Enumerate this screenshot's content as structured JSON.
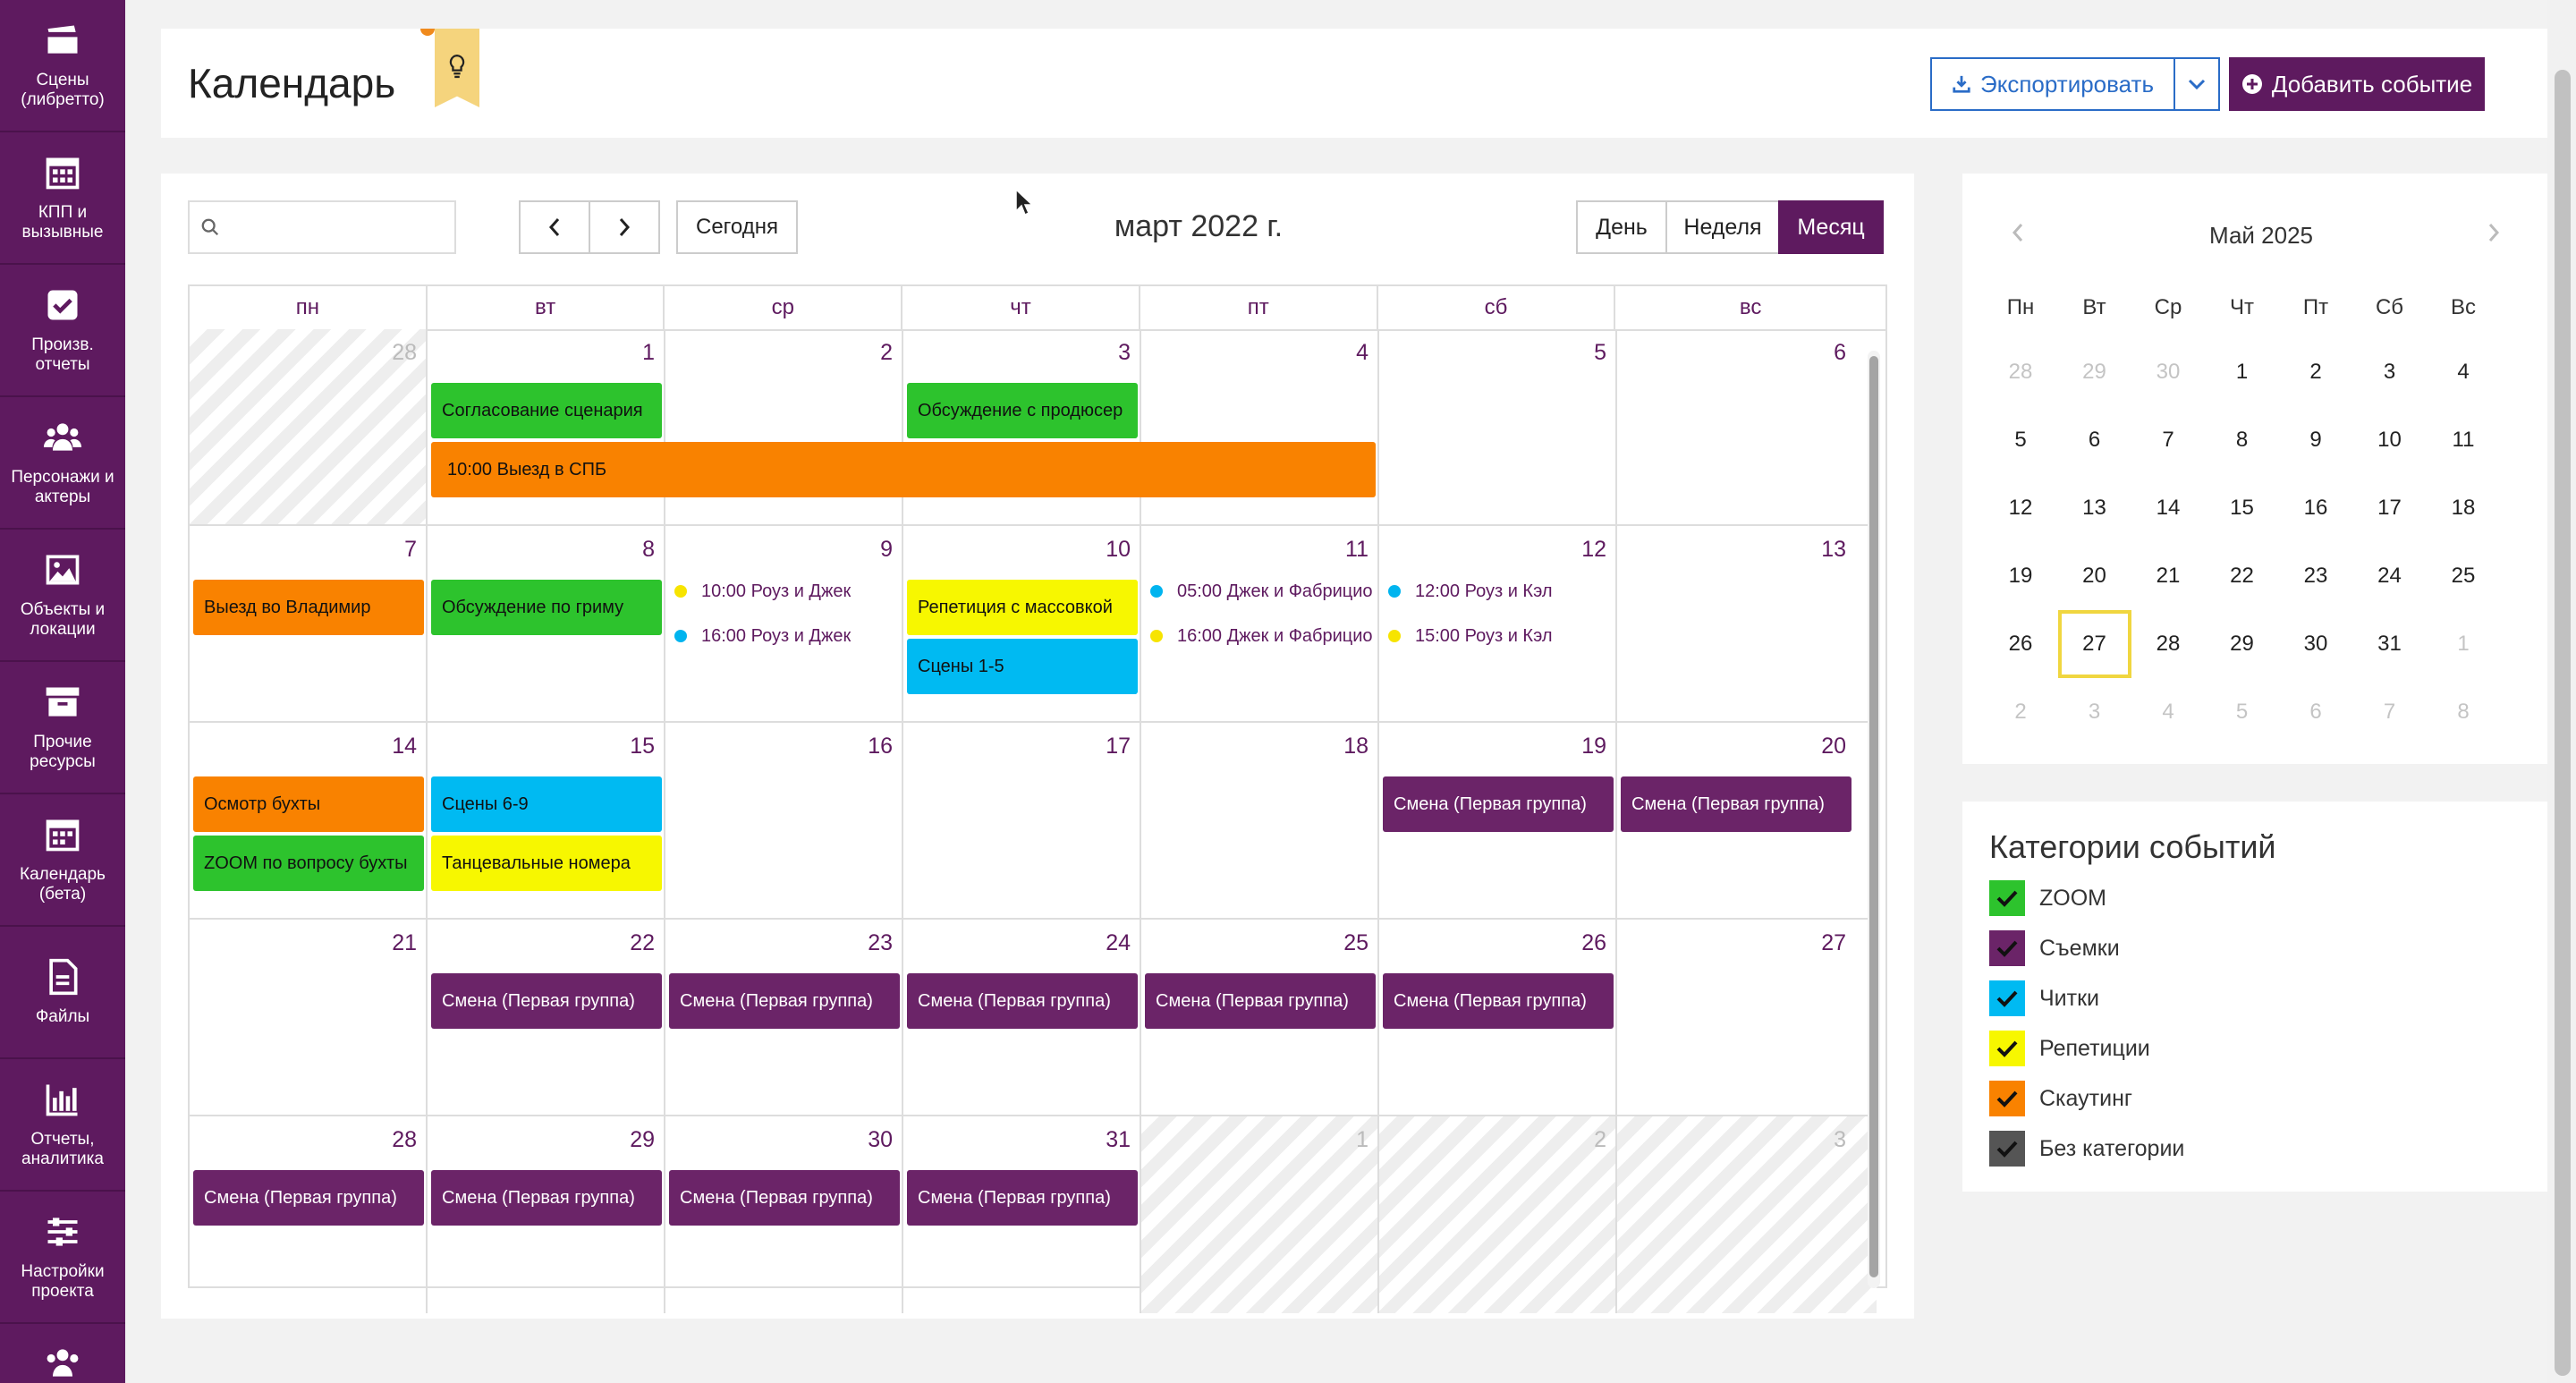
{
  "sidebar": {
    "items": [
      {
        "label": "Сцены (либретто)",
        "icon": "clapperboard-icon"
      },
      {
        "label": "КПП и вызывные",
        "icon": "calendar-grid-icon"
      },
      {
        "label": "Произв. отчеты",
        "icon": "checkbox-icon"
      },
      {
        "label": "Персонажи и актеры",
        "icon": "people-icon"
      },
      {
        "label": "Объекты и локации",
        "icon": "image-icon"
      },
      {
        "label": "Прочие ресурсы",
        "icon": "archive-icon"
      },
      {
        "label": "Календарь (бета)",
        "icon": "calendar-icon"
      },
      {
        "label": "Файлы",
        "icon": "file-icon"
      },
      {
        "label": "Отчеты, аналитика",
        "icon": "bar-chart-icon"
      },
      {
        "label": "Настройки проекта",
        "icon": "sliders-icon"
      }
    ]
  },
  "header": {
    "title": "Календарь",
    "export_label": "Экспортировать",
    "add_label": "Добавить событие"
  },
  "calendar": {
    "search_placeholder": "",
    "today_label": "Сегодня",
    "title": "март 2022 г.",
    "views": [
      {
        "label": "День",
        "active": false
      },
      {
        "label": "Неделя",
        "active": false
      },
      {
        "label": "Месяц",
        "active": true
      }
    ],
    "weekdays": [
      "пн",
      "вт",
      "ср",
      "чт",
      "пт",
      "сб",
      "вс"
    ],
    "weeks": [
      [
        {
          "d": "28",
          "other": true
        },
        {
          "d": "1"
        },
        {
          "d": "2"
        },
        {
          "d": "3"
        },
        {
          "d": "4"
        },
        {
          "d": "5"
        },
        {
          "d": "6"
        }
      ],
      [
        {
          "d": "7"
        },
        {
          "d": "8"
        },
        {
          "d": "9"
        },
        {
          "d": "10"
        },
        {
          "d": "11"
        },
        {
          "d": "12"
        },
        {
          "d": "13"
        }
      ],
      [
        {
          "d": "14"
        },
        {
          "d": "15"
        },
        {
          "d": "16"
        },
        {
          "d": "17"
        },
        {
          "d": "18"
        },
        {
          "d": "19"
        },
        {
          "d": "20"
        }
      ],
      [
        {
          "d": "21"
        },
        {
          "d": "22"
        },
        {
          "d": "23"
        },
        {
          "d": "24"
        },
        {
          "d": "25"
        },
        {
          "d": "26"
        },
        {
          "d": "27"
        }
      ],
      [
        {
          "d": "28"
        },
        {
          "d": "29"
        },
        {
          "d": "30"
        },
        {
          "d": "31"
        },
        {
          "d": "1",
          "other": true
        },
        {
          "d": "2",
          "other": true
        },
        {
          "d": "3",
          "other": true
        }
      ]
    ],
    "events": [
      {
        "week": 0,
        "col": 1,
        "span": 1,
        "slot": 0,
        "cat": "zoom",
        "label": "Согласование сценария"
      },
      {
        "week": 0,
        "col": 3,
        "span": 1,
        "slot": 0,
        "cat": "zoom",
        "label": "Обсуждение с продюсер"
      },
      {
        "week": 0,
        "col": 1,
        "span": 4,
        "slot": 1,
        "cat": "scout",
        "label": "10:00  Выезд в СПБ"
      },
      {
        "week": 1,
        "col": 0,
        "span": 1,
        "slot": 0,
        "cat": "scout",
        "label": "Выезд во Владимир"
      },
      {
        "week": 1,
        "col": 1,
        "span": 1,
        "slot": 0,
        "cat": "zoom",
        "label": "Обсуждение по гриму"
      },
      {
        "week": 1,
        "col": 3,
        "span": 1,
        "slot": 0,
        "cat": "rep",
        "label": "Репетиция с массовкой"
      },
      {
        "week": 1,
        "col": 3,
        "span": 1,
        "slot": 1,
        "cat": "read",
        "label": "Сцены 1-5"
      },
      {
        "week": 2,
        "col": 0,
        "span": 1,
        "slot": 0,
        "cat": "scout",
        "label": "Осмотр бухты"
      },
      {
        "week": 2,
        "col": 0,
        "span": 1,
        "slot": 1,
        "cat": "zoom",
        "label": "ZOOM по вопросу бухты"
      },
      {
        "week": 2,
        "col": 1,
        "span": 1,
        "slot": 0,
        "cat": "read",
        "label": "Сцены 6-9"
      },
      {
        "week": 2,
        "col": 1,
        "span": 1,
        "slot": 1,
        "cat": "rep",
        "label": "Танцевальные номера"
      },
      {
        "week": 2,
        "col": 5,
        "span": 1,
        "slot": 0,
        "cat": "shoot",
        "label": "Смена (Первая группа)"
      },
      {
        "week": 2,
        "col": 6,
        "span": 1,
        "slot": 0,
        "cat": "shoot",
        "label": "Смена (Первая группа)"
      },
      {
        "week": 3,
        "col": 1,
        "span": 1,
        "slot": 0,
        "cat": "shoot",
        "label": "Смена (Первая группа)"
      },
      {
        "week": 3,
        "col": 2,
        "span": 1,
        "slot": 0,
        "cat": "shoot",
        "label": "Смена (Первая группа)"
      },
      {
        "week": 3,
        "col": 3,
        "span": 1,
        "slot": 0,
        "cat": "shoot",
        "label": "Смена (Первая группа)"
      },
      {
        "week": 3,
        "col": 4,
        "span": 1,
        "slot": 0,
        "cat": "shoot",
        "label": "Смена (Первая группа)"
      },
      {
        "week": 3,
        "col": 5,
        "span": 1,
        "slot": 0,
        "cat": "shoot",
        "label": "Смена (Первая группа)"
      },
      {
        "week": 4,
        "col": 0,
        "span": 1,
        "slot": 0,
        "cat": "shoot",
        "label": "Смена (Первая группа)"
      },
      {
        "week": 4,
        "col": 1,
        "span": 1,
        "slot": 0,
        "cat": "shoot",
        "label": "Смена (Первая группа)"
      },
      {
        "week": 4,
        "col": 2,
        "span": 1,
        "slot": 0,
        "cat": "shoot",
        "label": "Смена (Первая группа)"
      },
      {
        "week": 4,
        "col": 3,
        "span": 1,
        "slot": 0,
        "cat": "shoot",
        "label": "Смена (Первая группа)"
      }
    ],
    "dot_events": [
      {
        "week": 1,
        "col": 2,
        "line": 0,
        "color": "y",
        "label": "10:00 Роуз и Джек"
      },
      {
        "week": 1,
        "col": 2,
        "line": 1,
        "color": "b",
        "label": "16:00 Роуз и Джек"
      },
      {
        "week": 1,
        "col": 4,
        "line": 0,
        "color": "b",
        "label": "05:00 Джек и Фабрицио"
      },
      {
        "week": 1,
        "col": 4,
        "line": 1,
        "color": "y",
        "label": "16:00 Джек и Фабрицио"
      },
      {
        "week": 1,
        "col": 5,
        "line": 0,
        "color": "b",
        "label": "12:00 Роуз и Кэл"
      },
      {
        "week": 1,
        "col": 5,
        "line": 1,
        "color": "y",
        "label": "15:00 Роуз и Кэл"
      }
    ]
  },
  "mini": {
    "title": "Май 2025",
    "weekdays": [
      "Пн",
      "Вт",
      "Ср",
      "Чт",
      "Пт",
      "Сб",
      "Вс"
    ],
    "weeks": [
      [
        {
          "d": "28",
          "m": true
        },
        {
          "d": "29",
          "m": true
        },
        {
          "d": "30",
          "m": true
        },
        {
          "d": "1"
        },
        {
          "d": "2"
        },
        {
          "d": "3"
        },
        {
          "d": "4"
        }
      ],
      [
        {
          "d": "5"
        },
        {
          "d": "6"
        },
        {
          "d": "7"
        },
        {
          "d": "8"
        },
        {
          "d": "9"
        },
        {
          "d": "10"
        },
        {
          "d": "11"
        }
      ],
      [
        {
          "d": "12"
        },
        {
          "d": "13"
        },
        {
          "d": "14"
        },
        {
          "d": "15"
        },
        {
          "d": "16"
        },
        {
          "d": "17"
        },
        {
          "d": "18"
        }
      ],
      [
        {
          "d": "19"
        },
        {
          "d": "20"
        },
        {
          "d": "21"
        },
        {
          "d": "22"
        },
        {
          "d": "23"
        },
        {
          "d": "24"
        },
        {
          "d": "25"
        }
      ],
      [
        {
          "d": "26"
        },
        {
          "d": "27",
          "today": true
        },
        {
          "d": "28"
        },
        {
          "d": "29"
        },
        {
          "d": "30"
        },
        {
          "d": "31"
        },
        {
          "d": "1",
          "m": true
        }
      ],
      [
        {
          "d": "2",
          "m": true
        },
        {
          "d": "3",
          "m": true
        },
        {
          "d": "4",
          "m": true
        },
        {
          "d": "5",
          "m": true
        },
        {
          "d": "6",
          "m": true
        },
        {
          "d": "7",
          "m": true
        },
        {
          "d": "8",
          "m": true
        }
      ]
    ]
  },
  "categories": {
    "title": "Категории событий",
    "items": [
      {
        "label": "ZOOM",
        "color": "#2dc32d"
      },
      {
        "label": "Съемки",
        "color": "#6b2468"
      },
      {
        "label": "Читки",
        "color": "#00baf2"
      },
      {
        "label": "Репетиции",
        "color": "#f7f700"
      },
      {
        "label": "Скаутинг",
        "color": "#f98200"
      },
      {
        "label": "Без категории",
        "color": "#555555"
      }
    ]
  },
  "colors": {
    "brand": "#5e1a5f",
    "accent_blue": "#2a6cc7",
    "today_border": "#f0d640"
  }
}
